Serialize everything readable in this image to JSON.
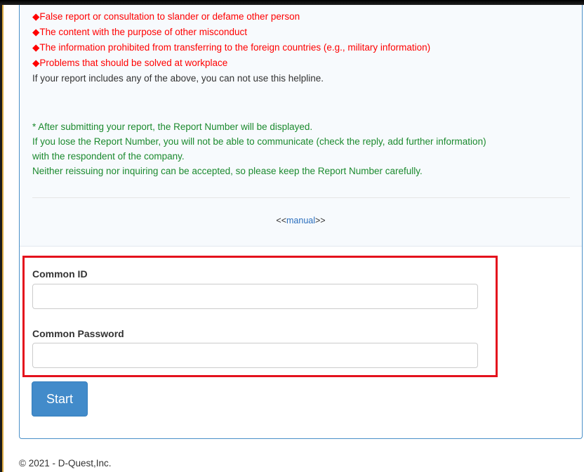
{
  "notice": {
    "bullet": "◆",
    "prohibited_items": [
      "False report or consultation to slander or defame other person",
      "The content with the purpose of other misconduct",
      "The information prohibited from transferring to the foreign countries (e.g., military information)",
      "Problems that should be solved at workplace"
    ],
    "warning": "If your report includes any of the above, you can not use this helpline.",
    "report_number_notes": [
      "* After submitting your report, the Report Number will be displayed.",
      "If you lose the Report Number, you will not be able to communicate (check the reply, add further information)",
      "with the respondent of the company.",
      "Neither reissuing nor inquiring can be accepted, so please keep the Report Number carefully."
    ]
  },
  "manual": {
    "prefix": "<<",
    "link_label": "manual",
    "suffix": ">>"
  },
  "login": {
    "id_label": "Common ID",
    "id_value": "",
    "password_label": "Common Password",
    "password_value": "",
    "start_label": "Start"
  },
  "footer": {
    "copyright": "© 2021 - D-Quest,Inc."
  },
  "colors": {
    "prohibited_text": "#ff0000",
    "note_text": "#1b8a2e",
    "link": "#2a6ebd",
    "primary_button": "#428bca",
    "highlight_box": "#e4121d",
    "panel_border": "#4a90c8"
  }
}
